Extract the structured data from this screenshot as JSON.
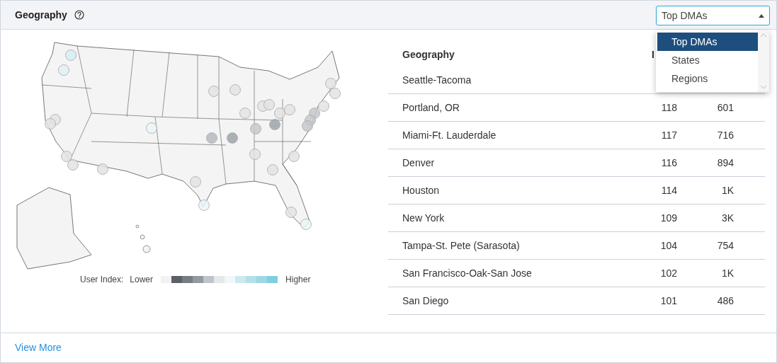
{
  "header": {
    "title": "Geography",
    "dropdown": {
      "value": "Top DMAs",
      "expanded": true,
      "options": [
        {
          "label": "Top DMAs",
          "selected": true
        },
        {
          "label": "States",
          "selected": false
        },
        {
          "label": "Regions",
          "selected": false
        }
      ]
    }
  },
  "legend": {
    "label": "User Index:",
    "low": "Lower",
    "high": "Higher",
    "swatches": [
      {
        "color": "#f2f2f2"
      },
      {
        "color": "#5c6168"
      },
      {
        "color": "#777d84"
      },
      {
        "color": "#949aa1"
      },
      {
        "color": "#bfc4cb"
      },
      {
        "color": "#e6e7e9"
      },
      {
        "color": "#f0f8fa"
      },
      {
        "color": "#cde9f0"
      },
      {
        "color": "#b3e0ea"
      },
      {
        "color": "#9dd8e4"
      },
      {
        "color": "#80cfe0"
      }
    ]
  },
  "table": {
    "columns": [
      "Geography",
      "I"
    ],
    "rows": [
      {
        "cells": [
          "Seattle-Tacoma"
        ]
      },
      {
        "cells": [
          "Portland, OR",
          "118",
          "601"
        ]
      },
      {
        "cells": [
          "Miami-Ft. Lauderdale",
          "117",
          "716"
        ]
      },
      {
        "cells": [
          "Denver",
          "116",
          "894"
        ]
      },
      {
        "cells": [
          "Houston",
          "114",
          "1K"
        ]
      },
      {
        "cells": [
          "New York",
          "109",
          "3K"
        ]
      },
      {
        "cells": [
          "Tampa-St. Pete (Sarasota)",
          "104",
          "754"
        ]
      },
      {
        "cells": [
          "San Francisco-Oak-San Jose",
          "102",
          "1K"
        ]
      },
      {
        "cells": [
          "San Diego",
          "101",
          "486"
        ]
      }
    ]
  },
  "footer": {
    "link": "View More"
  }
}
